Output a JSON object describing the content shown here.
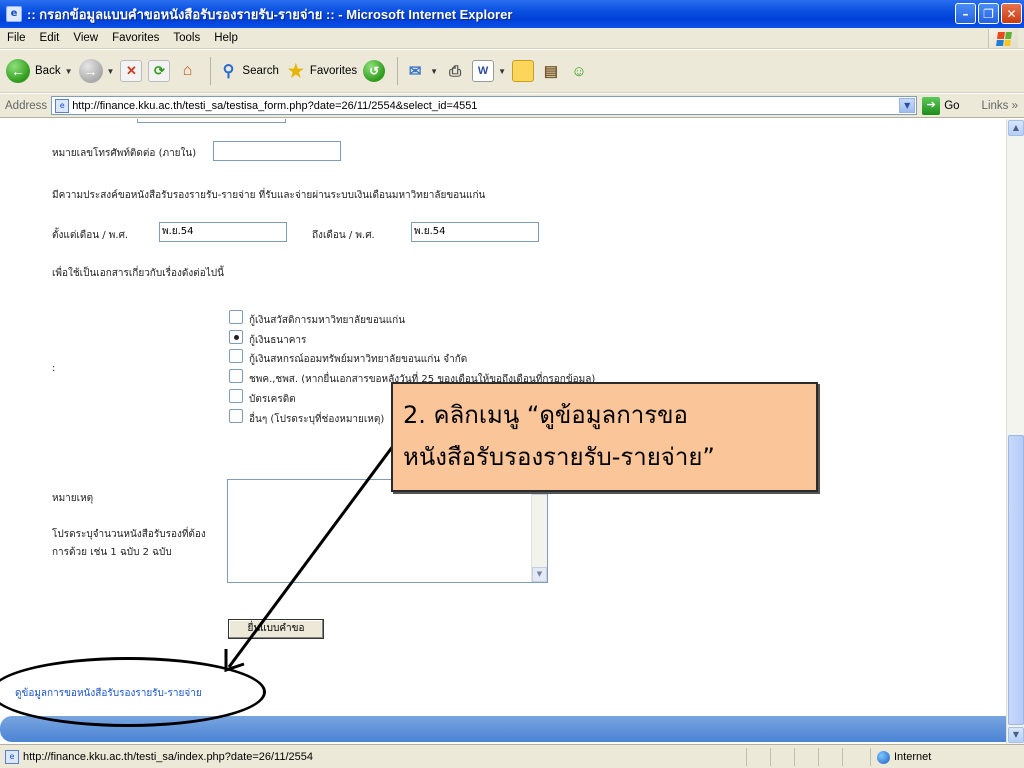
{
  "window": {
    "title": ":: กรอกข้อมูลแบบคำขอหนังสือรับรองรายรับ-รายจ่าย :: - Microsoft Internet Explorer"
  },
  "menu": [
    "File",
    "Edit",
    "View",
    "Favorites",
    "Tools",
    "Help"
  ],
  "toolbar": {
    "back_label": "Back",
    "search_label": "Search",
    "favorites_label": "Favorites"
  },
  "address": {
    "label": "Address",
    "url": "http://finance.kku.ac.th/testi_sa/testisa_form.php?date=26/11/2554&select_id=4551",
    "go_label": "Go",
    "links_label": "Links"
  },
  "form": {
    "phone_label": "หมายเลขโทรศัพท์ติดต่อ (ภายใน)",
    "phone_value": "",
    "purpose_text": "มีความประสงค์ขอหนังสือรับรองรายรับ-รายจ่าย  ที่รับและจ่ายผ่านระบบเงินเดือนมหาวิทยาลัยขอนแก่น",
    "from_label": "ตั้งแต่เดือน / พ.ศ.",
    "from_value": "พ.ย.54",
    "to_label": "ถึงเดือน / พ.ศ.",
    "to_value": "พ.ย.54",
    "use_for_label": "เพื่อใช้เป็นเอกสารเกี่ยวกับเรื่องดังต่อไปนี้",
    "colon": ":",
    "options": [
      {
        "label": "กู้เงินสวัสดิการมหาวิทยาลัยขอนแก่น",
        "checked": false
      },
      {
        "label": "กู้เงินธนาคาร",
        "checked": true
      },
      {
        "label": "กู้เงินสหกรณ์ออมทรัพย์มหาวิทยาลัยขอนแก่น จำกัด",
        "checked": false
      },
      {
        "label": "ชพค.,ชพส. (หากยื่นเอกสารขอหลังวันที่ 25 ของเดือนให้ขอถึงเดือนที่กรอกข้อมูล)",
        "checked": false
      },
      {
        "label": "บัตรเครดิต",
        "checked": false
      },
      {
        "label": "อื่นๆ (โปรดระบุที่ช่องหมายเหตุ)",
        "checked": false
      }
    ],
    "remark_label": "หมายเหตุ",
    "copies_label_1": "โปรดระบุจำนวนหนังสือรับรองที่ต้อง",
    "copies_label_2": "การด้วย เช่น 1 ฉบับ 2 ฉบับ",
    "submit_label": "ยื่นแบบคำขอ",
    "view_link": "ดูข้อมูลการขอหนังสือรับรองรายรับ-รายจ่าย"
  },
  "callout": {
    "line1": "2. คลิกเมนู “ดูข้อมูลการขอ",
    "line2": "หนังสือรับรองรายรับ-รายจ่าย”"
  },
  "status": {
    "text": "http://finance.kku.ac.th/testi_sa/index.php?date=26/11/2554",
    "zone": "Internet"
  }
}
